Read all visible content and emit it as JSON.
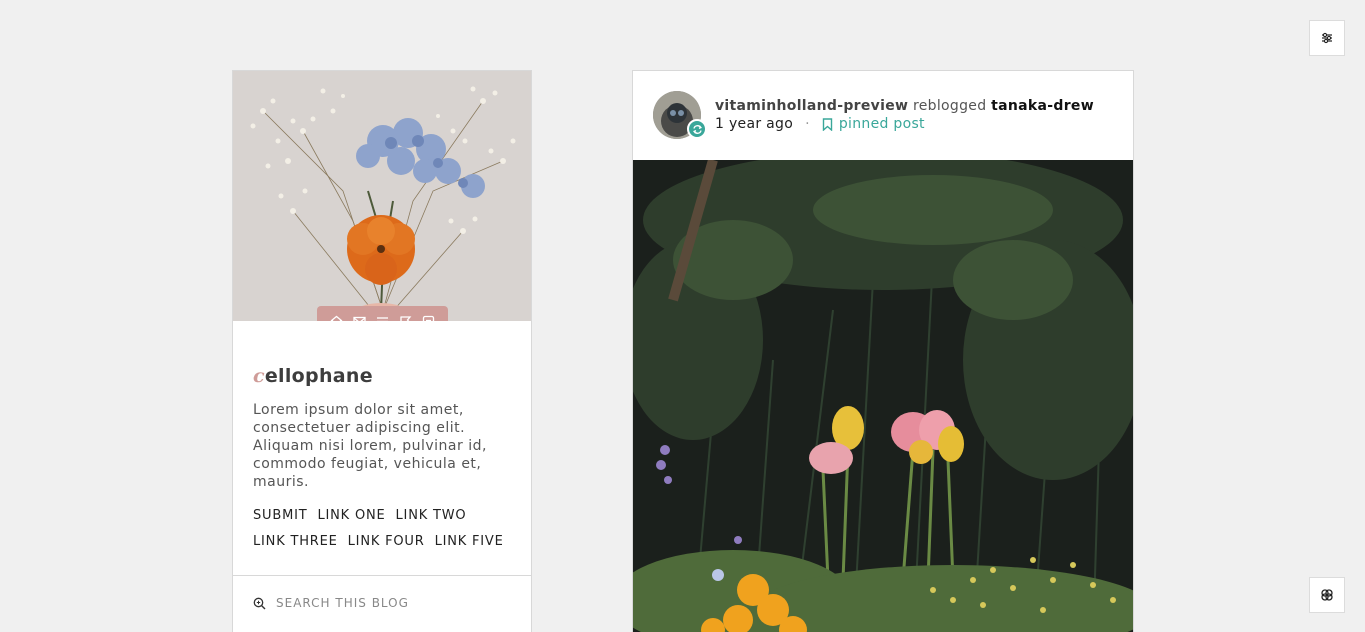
{
  "controls": {
    "top_icon": "sliders-icon",
    "bottom_icon": "theme-credit-icon"
  },
  "sidebar": {
    "icon_bar": [
      "home-icon",
      "mail-icon",
      "menu-icon",
      "tag-icon",
      "archive-icon"
    ],
    "title_first_letter": "c",
    "title_rest": "ellophane",
    "description": "Lorem ipsum dolor sit amet, consectetuer adipiscing elit. Aliquam nisi lorem, pulvinar id, commodo feugiat, vehicula et, mauris.",
    "links": [
      "SUBMIT",
      "LINK ONE",
      "LINK TWO",
      "LINK THREE",
      "LINK FOUR",
      "LINK FIVE"
    ],
    "search": {
      "placeholder": "SEARCH THIS BLOG",
      "icon": "search-icon"
    }
  },
  "post": {
    "username": "vitaminholland-preview",
    "action": "reblogged",
    "original_poster": "tanaka-drew",
    "time": "1 year ago",
    "separator": "·",
    "pinned_label": "pinned post"
  },
  "colors": {
    "accent": "#cf9c98",
    "reblog": "#3aa79a",
    "background": "#f0f0f0"
  }
}
